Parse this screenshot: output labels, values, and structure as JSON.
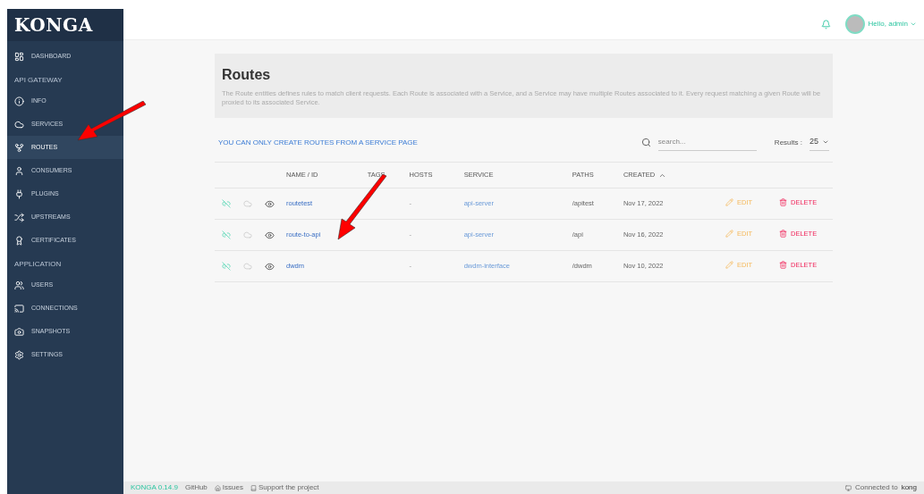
{
  "sidebar": {
    "logo": "KONGA",
    "items": [
      {
        "kind": "item",
        "label": "DASHBOARD",
        "selected": false
      },
      {
        "kind": "header",
        "label": "API GATEWAY"
      },
      {
        "kind": "item",
        "label": "INFO",
        "selected": false
      },
      {
        "kind": "item",
        "label": "SERVICES",
        "selected": false
      },
      {
        "kind": "item",
        "label": "ROUTES",
        "selected": true
      },
      {
        "kind": "item",
        "label": "CONSUMERS",
        "selected": false
      },
      {
        "kind": "item",
        "label": "PLUGINS",
        "selected": false
      },
      {
        "kind": "item",
        "label": "UPSTREAMS",
        "selected": false
      },
      {
        "kind": "item",
        "label": "CERTIFICATES",
        "selected": false
      },
      {
        "kind": "header",
        "label": "APPLICATION"
      },
      {
        "kind": "item",
        "label": "USERS",
        "selected": false
      },
      {
        "kind": "item",
        "label": "CONNECTIONS",
        "selected": false
      },
      {
        "kind": "item",
        "label": "SNAPSHOTS",
        "selected": false
      },
      {
        "kind": "item",
        "label": "SETTINGS",
        "selected": false
      }
    ]
  },
  "topbar": {
    "greeting": "Hello, admin"
  },
  "header": {
    "title": "Routes",
    "description": "The Route entities defines rules to match client requests. Each Route is associated with a Service, and a Service may have multiple Routes associated to it. Every request matching a given Route will be proxied to its associated Service."
  },
  "toolbar": {
    "notice": "YOU CAN ONLY CREATE ROUTES FROM A SERVICE PAGE",
    "search_placeholder": "search...",
    "results_label": "Results :",
    "results_value": "25"
  },
  "table": {
    "columns": [
      "NAME / ID",
      "TAGS",
      "HOSTS",
      "SERVICE",
      "PATHS",
      "CREATED"
    ],
    "rows": [
      {
        "name": "routetest",
        "hosts": "-",
        "service": "api-server",
        "paths": "/apitest",
        "created": "Nov 17, 2022",
        "edit": "EDIT",
        "delete": "DELETE"
      },
      {
        "name": "route-to-api",
        "hosts": "-",
        "service": "api-server",
        "paths": "/api",
        "created": "Nov 16, 2022",
        "edit": "EDIT",
        "delete": "DELETE"
      },
      {
        "name": "dwdm",
        "hosts": "-",
        "service": "dwdm-interface",
        "paths": "/dwdm",
        "created": "Nov 10, 2022",
        "edit": "EDIT",
        "delete": "DELETE"
      }
    ]
  },
  "footer": {
    "version": "KONGA 0.14.9",
    "links": [
      "GitHub",
      "Issues",
      "Support the project"
    ],
    "status": "Connected to",
    "connection": "kong"
  }
}
